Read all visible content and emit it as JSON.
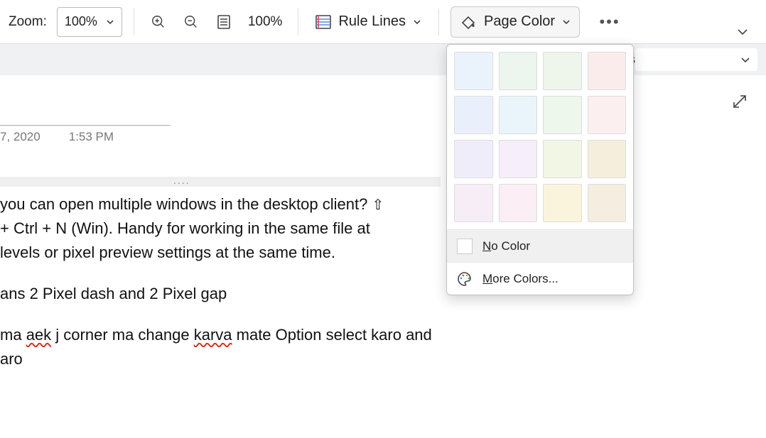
{
  "toolbar": {
    "zoom_label": "Zoom:",
    "zoom_value": "100%",
    "zoom_pct_display": "100%",
    "rule_lines_label": "Rule Lines",
    "page_color_label": "Page Color"
  },
  "sub_strip": {
    "trailing_text": "ts"
  },
  "meta": {
    "date": "7, 2020",
    "time": "1:53 PM"
  },
  "body": {
    "p1_l1": "you can open multiple windows in the desktop client? ",
    "p1_l2": "+ Ctrl + N (Win). Handy for working in the same file at",
    "p1_l3": " levels or pixel preview settings at the same time.",
    "p2": "ans 2 Pixel dash and 2 Pixel gap",
    "p3_pre": "ma ",
    "p3_s1": "aek",
    "p3_mid1": " j corner ma change ",
    "p3_s2": "karva",
    "p3_mid2": " mate Option select karo and",
    "p3_l2": "aro"
  },
  "page_color_popup": {
    "swatches": [
      "#eaf3fb",
      "#ecf6ef",
      "#eef6eb",
      "#fbecec",
      "#eaf0fb",
      "#eaf5fb",
      "#eef7ec",
      "#fcefef",
      "#f0edfb",
      "#f6eefb",
      "#f2f6e5",
      "#f6eedd",
      "#f6edf6",
      "#fbeef5",
      "#fbf4dc",
      "#f4ede0"
    ],
    "no_color_label": "No Color",
    "more_colors_label": "More Colors..."
  }
}
